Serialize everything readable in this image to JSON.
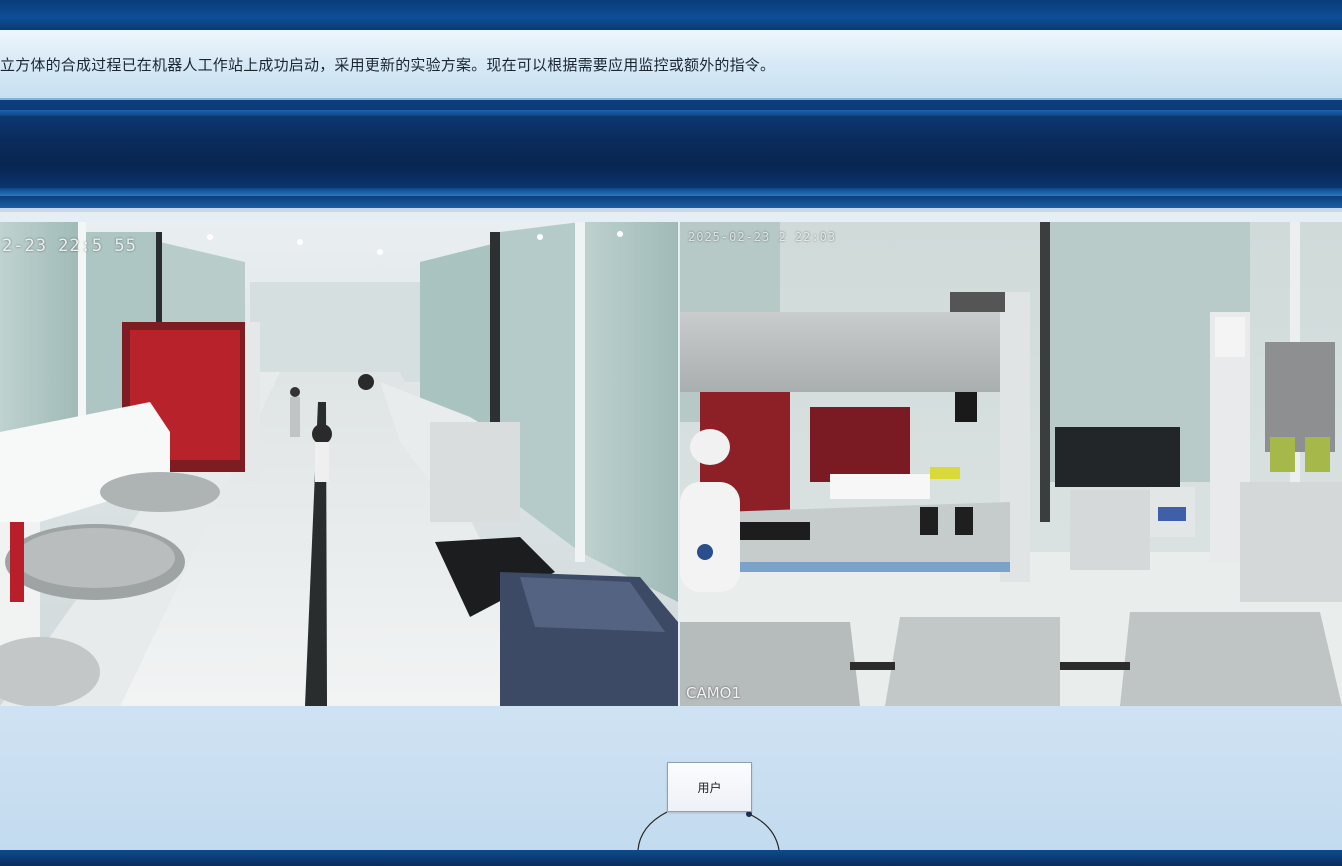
{
  "message": {
    "text": "立方体的合成过程已在机器人工作站上成功启动，采用更新的实验方案。现在可以根据需要应用监控或额外的指令。"
  },
  "cameras": {
    "left": {
      "timestamp": "2-23 22:5 55"
    },
    "right": {
      "timestamp": "2025-02-23 2 22:03",
      "label": "CAMO1"
    }
  },
  "flow": {
    "user_node_label": "用户"
  },
  "colors": {
    "accent_dark": "#0b2a5a",
    "message_bg": "#d7e9f6",
    "flow_bg": "#c8deF1"
  }
}
